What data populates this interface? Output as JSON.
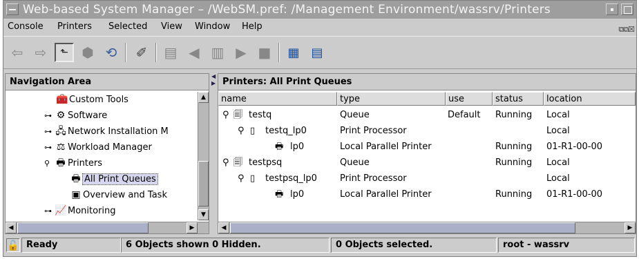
{
  "window": {
    "title": "Web-based System Manager – /WebSM.pref: /Management Environment/wassrv/Printers"
  },
  "menu": [
    {
      "label": "Console"
    },
    {
      "label": "Printers"
    },
    {
      "label": "Selected"
    },
    {
      "label": "View"
    },
    {
      "label": "Window"
    },
    {
      "label": "Help"
    }
  ],
  "toolbar": {
    "icons": [
      "back-arrow-icon",
      "forward-arrow-icon",
      "up-level-icon",
      "stop-icon",
      "reload-icon",
      "find-icon",
      "properties-icon",
      "open-icon",
      "delete-icon",
      "start-icon",
      "stop-queue-icon",
      "tree-view-icon",
      "details-view-icon"
    ]
  },
  "nav": {
    "heading": "Navigation Area",
    "items": [
      {
        "label": "Custom Tools",
        "icon": "toolbox-icon"
      },
      {
        "label": "Software",
        "icon": "software-icon"
      },
      {
        "label": "Network Installation M",
        "icon": "network-install-icon"
      },
      {
        "label": "Workload Manager",
        "icon": "workload-icon"
      },
      {
        "label": "Printers",
        "icon": "printer-icon"
      },
      {
        "label": "All Print Queues",
        "icon": "printer-icon"
      },
      {
        "label": "Overview and Task",
        "icon": "overview-icon"
      },
      {
        "label": "Monitoring",
        "icon": "monitor-icon"
      }
    ]
  },
  "main": {
    "heading": "Printers: All Print Queues",
    "columns": [
      {
        "label": "name"
      },
      {
        "label": "type"
      },
      {
        "label": "use"
      },
      {
        "label": "status"
      },
      {
        "label": "location"
      }
    ],
    "rows": [
      {
        "name": "testq",
        "type": "Queue",
        "use": "Default",
        "status": "Running",
        "location": "Local",
        "icon": "queue-icon"
      },
      {
        "name": "testq_lp0",
        "type": "Print Processor",
        "use": "",
        "status": "",
        "location": "Local",
        "icon": "document-icon"
      },
      {
        "name": "lp0",
        "type": "Local Parallel Printer",
        "use": "",
        "status": "Running",
        "location": "01-R1-00-00",
        "icon": "printer-icon"
      },
      {
        "name": "testpsq",
        "type": "Queue",
        "use": "",
        "status": "Running",
        "location": "Local",
        "icon": "queue-icon"
      },
      {
        "name": "testpsq_lp0",
        "type": "Print Processor",
        "use": "",
        "status": "",
        "location": "Local",
        "icon": "document-icon"
      },
      {
        "name": "lp0",
        "type": "Local Parallel Printer",
        "use": "",
        "status": "Running",
        "location": "01-R1-00-00",
        "icon": "printer-icon"
      }
    ]
  },
  "status": {
    "ready": "Ready",
    "shown": "6 Objects shown 0 Hidden.",
    "selected": "0 Objects selected.",
    "host": "root - wassrv"
  }
}
